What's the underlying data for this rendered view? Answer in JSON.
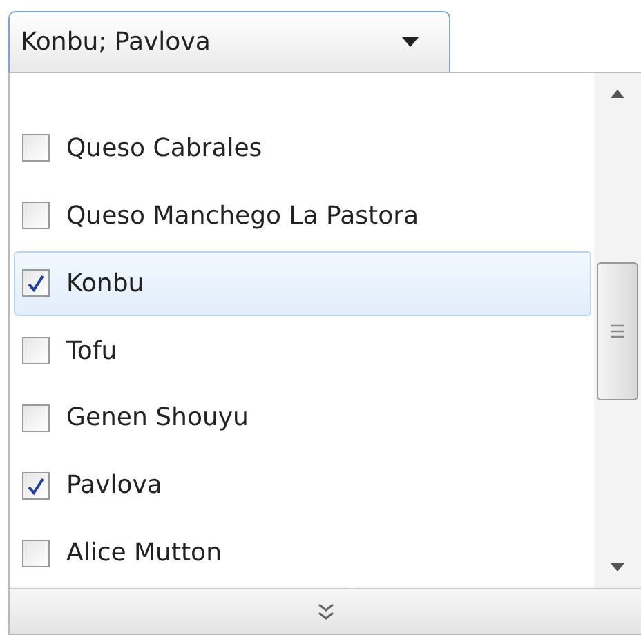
{
  "combo": {
    "value": "Konbu; Pavlova"
  },
  "items": [
    {
      "label": "Queso Cabrales",
      "checked": false,
      "selected": false
    },
    {
      "label": "Queso Manchego La Pastora",
      "checked": false,
      "selected": false
    },
    {
      "label": "Konbu",
      "checked": true,
      "selected": true
    },
    {
      "label": "Tofu",
      "checked": false,
      "selected": false
    },
    {
      "label": "Genen Shouyu",
      "checked": false,
      "selected": false
    },
    {
      "label": "Pavlova",
      "checked": true,
      "selected": false
    },
    {
      "label": "Alice Mutton",
      "checked": false,
      "selected": false
    }
  ]
}
